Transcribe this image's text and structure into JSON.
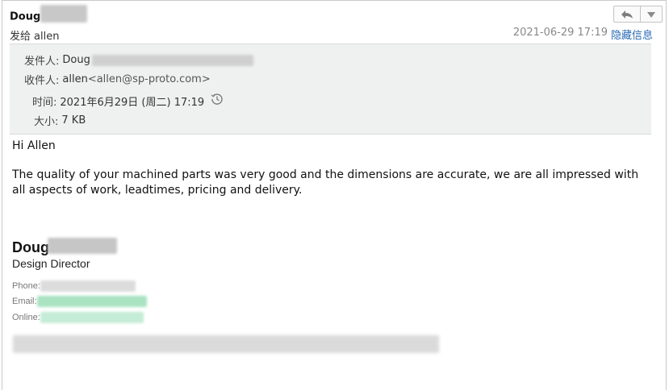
{
  "header": {
    "sender_name": "Doug",
    "to_prefix": "发给",
    "to_name": "allen",
    "datetime": "2021-06-29 17:19",
    "hide_info_link": "隐藏信息",
    "reply_icon": "reply-icon",
    "more_icon": "chevron-down-icon"
  },
  "details": {
    "from_label": "发件人:",
    "from_value": "Doug",
    "to_label": "收件人:",
    "to_name": "allen",
    "to_addr": "<allen@sp-proto.com>",
    "time_label": "时间:",
    "time_value": "2021年6月29日 (周二) 17:19",
    "time_icon": "history-clock-icon",
    "size_label": "大小:",
    "size_value": "7 KB"
  },
  "body": {
    "greeting": "Hi Allen",
    "paragraph": "The quality of your machined parts was very good and the dimensions are accurate,  we are all impressed with all aspects of work, leadtimes, pricing and delivery."
  },
  "signature": {
    "name": "Doug",
    "title": "Design Director",
    "phone_label": "Phone:",
    "email_label": "Email:",
    "online_label": "Online:"
  },
  "colors": {
    "link": "#2a6ab3",
    "details_bg": "#eef1ef",
    "muted": "#888888"
  }
}
